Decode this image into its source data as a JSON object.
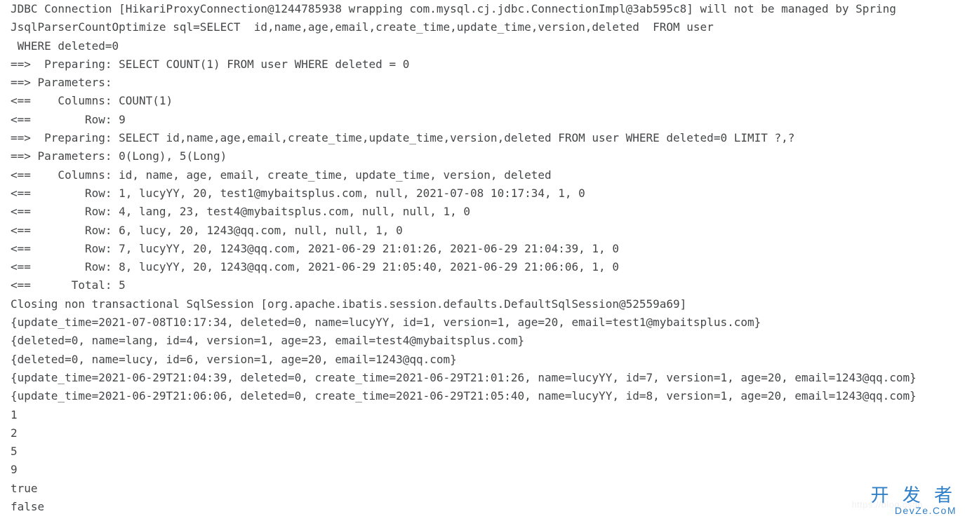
{
  "log": {
    "lines": [
      "JDBC Connection [HikariProxyConnection@1244785938 wrapping com.mysql.cj.jdbc.ConnectionImpl@3ab595c8] will not be managed by Spring",
      "JsqlParserCountOptimize sql=SELECT  id,name,age,email,create_time,update_time,version,deleted  FROM user",
      " WHERE deleted=0",
      "==>  Preparing: SELECT COUNT(1) FROM user WHERE deleted = 0",
      "==> Parameters:",
      "<==    Columns: COUNT(1)",
      "<==        Row: 9",
      "==>  Preparing: SELECT id,name,age,email,create_time,update_time,version,deleted FROM user WHERE deleted=0 LIMIT ?,?",
      "==> Parameters: 0(Long), 5(Long)",
      "<==    Columns: id, name, age, email, create_time, update_time, version, deleted",
      "<==        Row: 1, lucyYY, 20, test1@mybaitsplus.com, null, 2021-07-08 10:17:34, 1, 0",
      "<==        Row: 4, lang, 23, test4@mybaitsplus.com, null, null, 1, 0",
      "<==        Row: 6, lucy, 20, 1243@qq.com, null, null, 1, 0",
      "<==        Row: 7, lucyYY, 20, 1243@qq.com, 2021-06-29 21:01:26, 2021-06-29 21:04:39, 1, 0",
      "<==        Row: 8, lucyYY, 20, 1243@qq.com, 2021-06-29 21:05:40, 2021-06-29 21:06:06, 1, 0",
      "<==      Total: 5",
      "Closing non transactional SqlSession [org.apache.ibatis.session.defaults.DefaultSqlSession@52559a69]",
      "{update_time=2021-07-08T10:17:34, deleted=0, name=lucyYY, id=1, version=1, age=20, email=test1@mybaitsplus.com}",
      "{deleted=0, name=lang, id=4, version=1, age=23, email=test4@mybaitsplus.com}",
      "{deleted=0, name=lucy, id=6, version=1, age=20, email=1243@qq.com}",
      "{update_time=2021-06-29T21:04:39, deleted=0, create_time=2021-06-29T21:01:26, name=lucyYY, id=7, version=1, age=20, email=1243@qq.com}",
      "{update_time=2021-06-29T21:06:06, deleted=0, create_time=2021-06-29T21:05:40, name=lucyYY, id=8, version=1, age=20, email=1243@qq.com}",
      "1",
      "2",
      "5",
      "9",
      "true",
      "false"
    ]
  },
  "watermark": {
    "faint": "https://blog.csdn",
    "brand_top": "开 发 者",
    "brand_sub": "DevZe.CoM"
  }
}
